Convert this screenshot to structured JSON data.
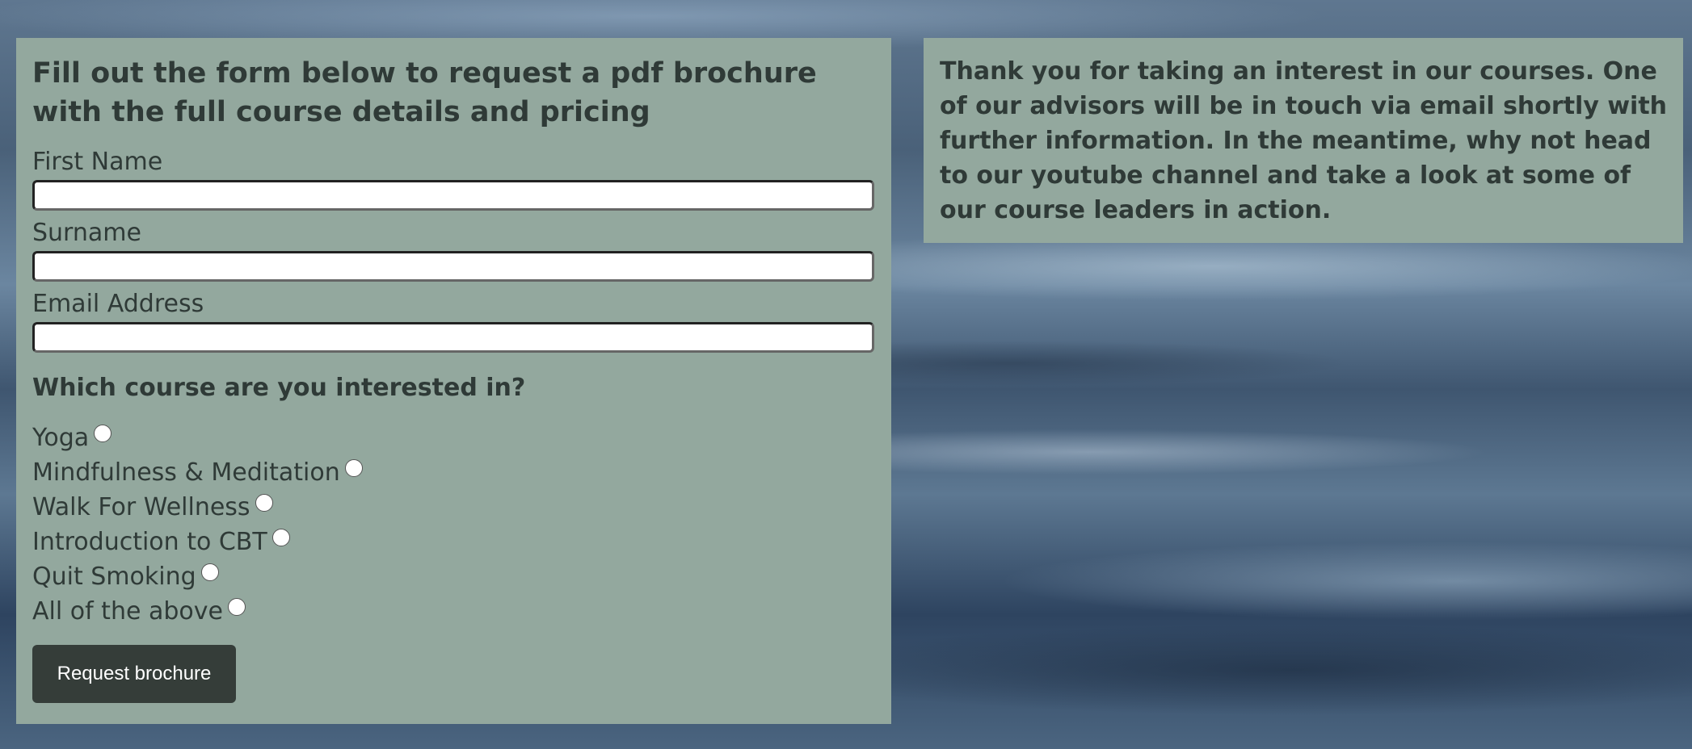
{
  "form": {
    "title": "Fill out the form below to request a pdf brochure with the full course details and pricing",
    "fields": [
      {
        "label": "First Name",
        "value": ""
      },
      {
        "label": "Surname",
        "value": ""
      },
      {
        "label": "Email Address",
        "value": ""
      }
    ],
    "question": "Which course are you interested in?",
    "options": [
      {
        "label": "Yoga",
        "checked": false
      },
      {
        "label": "Mindfulness & Meditation",
        "checked": false
      },
      {
        "label": "Walk For Wellness",
        "checked": false
      },
      {
        "label": "Introduction to CBT",
        "checked": false
      },
      {
        "label": "Quit Smoking",
        "checked": false
      },
      {
        "label": "All of the above",
        "checked": false
      }
    ],
    "submit_label": "Request brochure"
  },
  "info": {
    "message": "Thank you for taking an interest in our courses. One of our advisors will be in touch via email shortly with further information. In the meantime, why not head to our youtube channel and take a look at some of our course leaders in action."
  },
  "colors": {
    "panel": "#93a89e",
    "button": "#353d39",
    "text": "#2f3a37"
  }
}
